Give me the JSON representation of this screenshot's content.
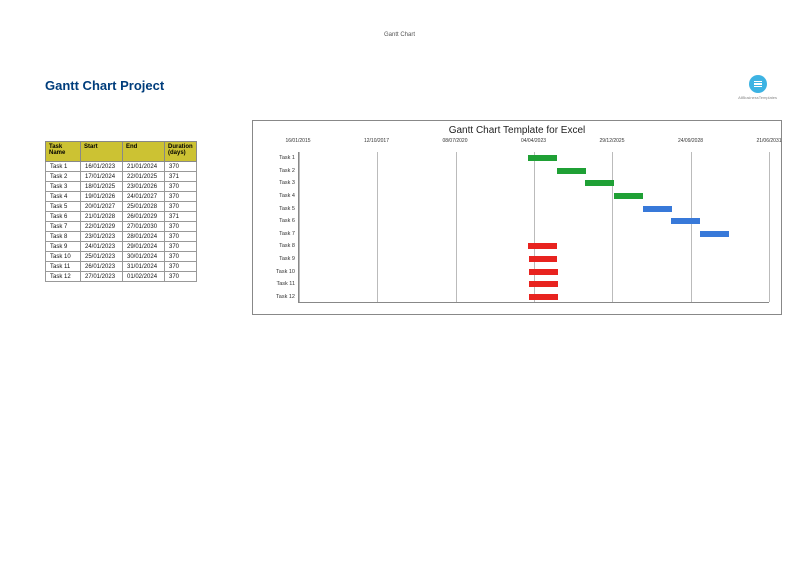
{
  "top_label": "Gantt Chart",
  "project_title": "Gantt Chart Project",
  "logo_text": "AllBusinessTemplates",
  "table": {
    "headers": {
      "name": "Task Name",
      "start": "Start",
      "end": "End",
      "duration": "Duration (days)"
    },
    "rows": [
      {
        "name": "Task 1",
        "start": "16/01/2023",
        "end": "21/01/2024",
        "duration": "370"
      },
      {
        "name": "Task 2",
        "start": "17/01/2024",
        "end": "22/01/2025",
        "duration": "371"
      },
      {
        "name": "Task 3",
        "start": "18/01/2025",
        "end": "23/01/2026",
        "duration": "370"
      },
      {
        "name": "Task 4",
        "start": "19/01/2026",
        "end": "24/01/2027",
        "duration": "370"
      },
      {
        "name": "Task 5",
        "start": "20/01/2027",
        "end": "25/01/2028",
        "duration": "370"
      },
      {
        "name": "Task 6",
        "start": "21/01/2028",
        "end": "26/01/2029",
        "duration": "371"
      },
      {
        "name": "Task 7",
        "start": "22/01/2029",
        "end": "27/01/2030",
        "duration": "370"
      },
      {
        "name": "Task 8",
        "start": "23/01/2023",
        "end": "28/01/2024",
        "duration": "370"
      },
      {
        "name": "Task 9",
        "start": "24/01/2023",
        "end": "29/01/2024",
        "duration": "370"
      },
      {
        "name": "Task 10",
        "start": "25/01/2023",
        "end": "30/01/2024",
        "duration": "370"
      },
      {
        "name": "Task 11",
        "start": "26/01/2023",
        "end": "31/01/2024",
        "duration": "370"
      },
      {
        "name": "Task 12",
        "start": "27/01/2023",
        "end": "01/02/2024",
        "duration": "370"
      }
    ]
  },
  "chart_data": {
    "type": "bar",
    "title": "Gantt Chart Template for Excel",
    "x_ticks": [
      "16/01/2015",
      "12/10/2017",
      "08/07/2020",
      "04/04/2023",
      "29/12/2025",
      "24/09/2028",
      "21/06/2031"
    ],
    "x_range_days": [
      0,
      6000
    ],
    "categories": [
      "Task 1",
      "Task 2",
      "Task 3",
      "Task 4",
      "Task 5",
      "Task 6",
      "Task 7",
      "Task 8",
      "Task 9",
      "Task 10",
      "Task 11",
      "Task 12"
    ],
    "series": [
      {
        "name": "Task 1",
        "start_day": 2922,
        "duration": 370,
        "color": "green"
      },
      {
        "name": "Task 2",
        "start_day": 3288,
        "duration": 371,
        "color": "green"
      },
      {
        "name": "Task 3",
        "start_day": 3654,
        "duration": 370,
        "color": "green"
      },
      {
        "name": "Task 4",
        "start_day": 4020,
        "duration": 370,
        "color": "green"
      },
      {
        "name": "Task 5",
        "start_day": 4386,
        "duration": 370,
        "color": "blue"
      },
      {
        "name": "Task 6",
        "start_day": 4752,
        "duration": 371,
        "color": "blue"
      },
      {
        "name": "Task 7",
        "start_day": 5119,
        "duration": 370,
        "color": "blue"
      },
      {
        "name": "Task 8",
        "start_day": 2929,
        "duration": 370,
        "color": "red"
      },
      {
        "name": "Task 9",
        "start_day": 2930,
        "duration": 370,
        "color": "red"
      },
      {
        "name": "Task 10",
        "start_day": 2931,
        "duration": 370,
        "color": "red"
      },
      {
        "name": "Task 11",
        "start_day": 2932,
        "duration": 370,
        "color": "red"
      },
      {
        "name": "Task 12",
        "start_day": 2933,
        "duration": 370,
        "color": "red"
      }
    ]
  }
}
